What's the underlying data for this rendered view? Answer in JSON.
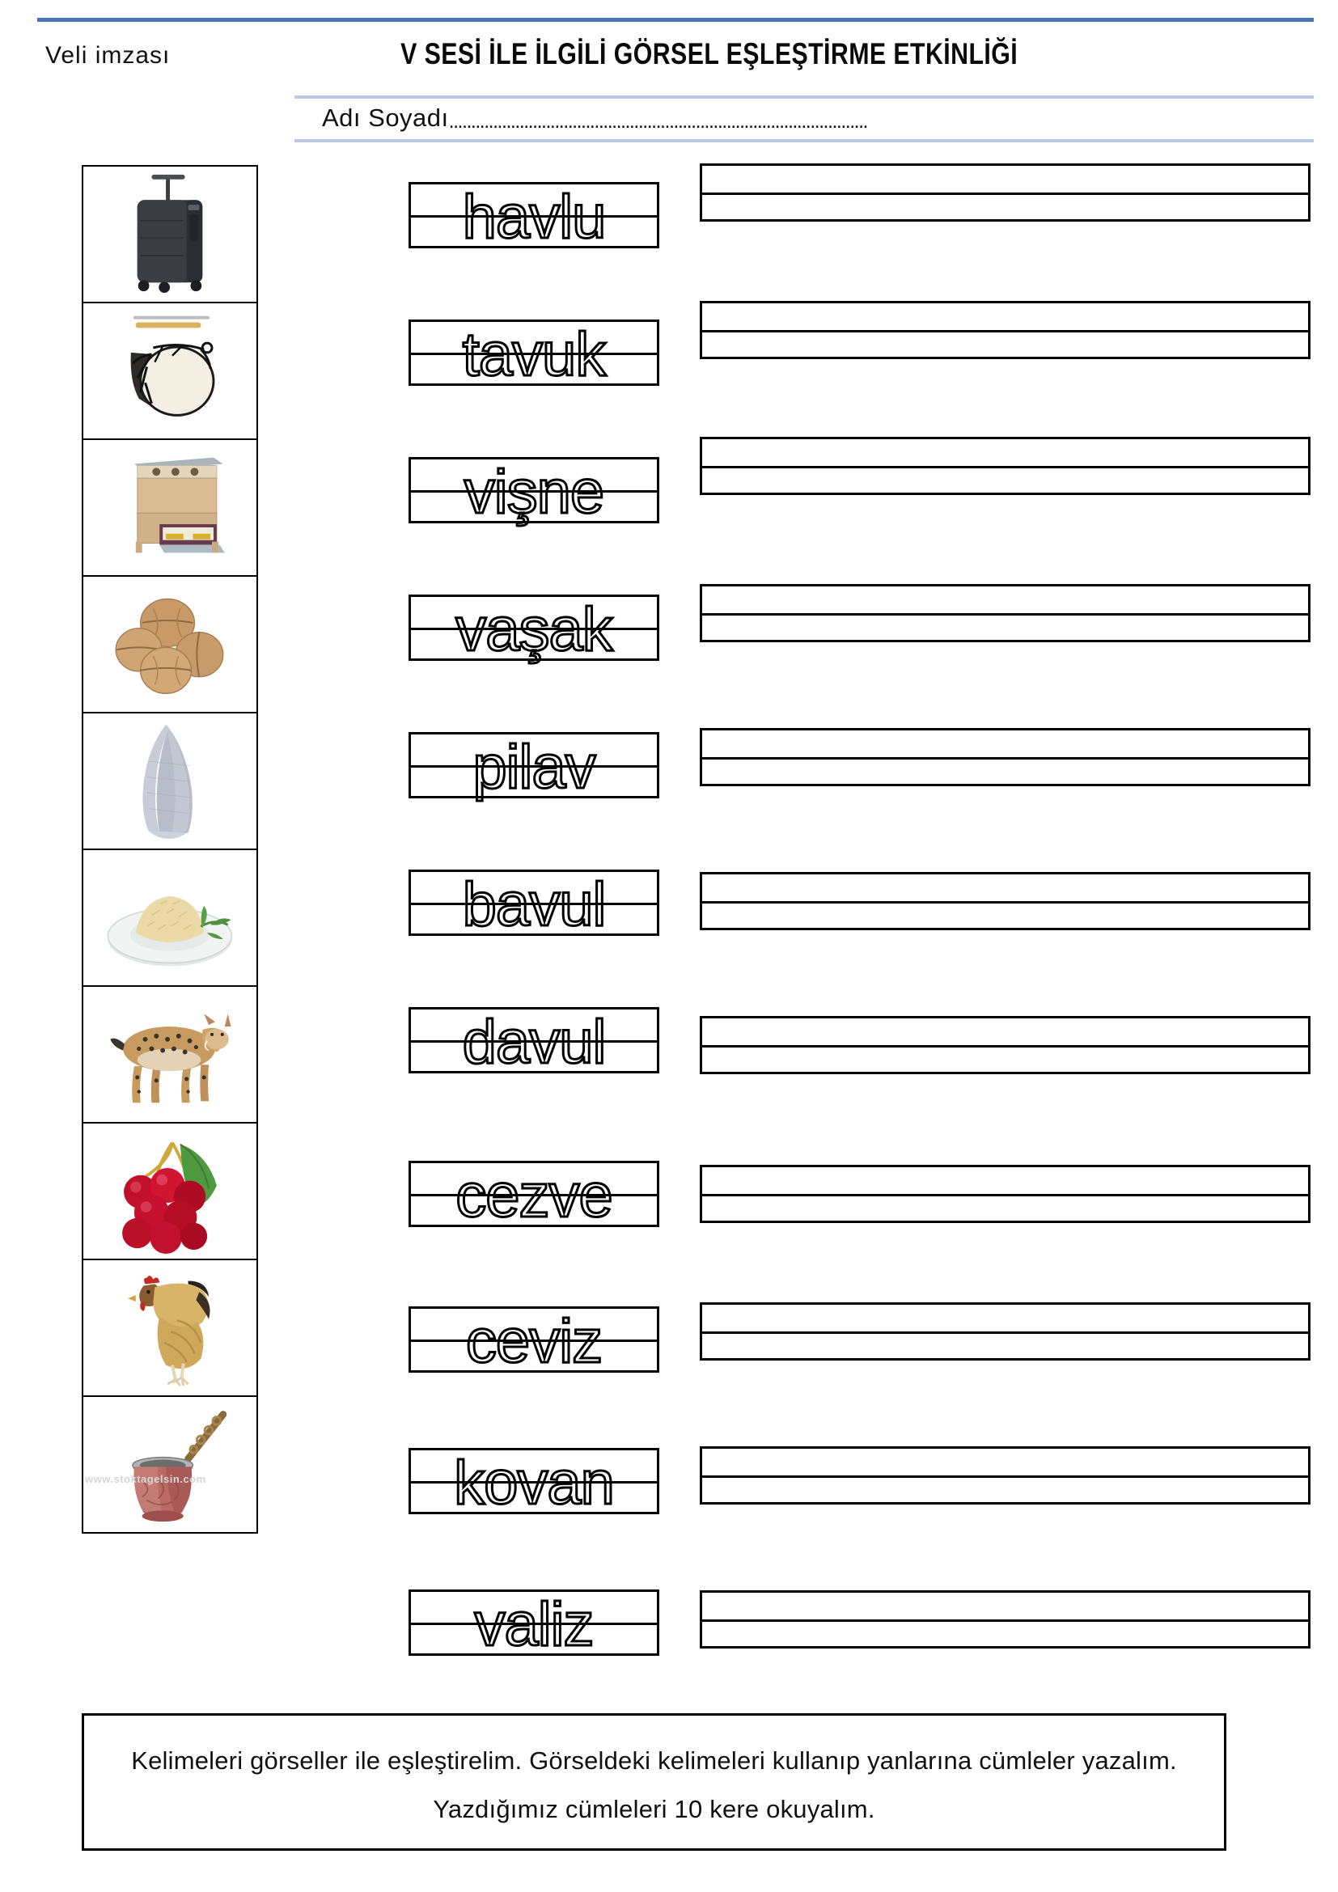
{
  "header": {
    "parent_signature_label": "Veli imzası",
    "title": "V SESİ İLE İLGİLİ GÖRSEL EŞLEŞTİRME ETKİNLİĞİ",
    "name_label": "Adı Soyadı",
    "name_dots": "...............................................................................................",
    "name_value": "",
    "rule_accent_color": "#4a76b8",
    "rule_light_color": "#bcc8e4"
  },
  "images": [
    {
      "name": "suitcase",
      "word": "bavul",
      "watermark": ""
    },
    {
      "name": "drum",
      "word": "davul",
      "watermark": ""
    },
    {
      "name": "beehive",
      "word": "kovan",
      "watermark": ""
    },
    {
      "name": "walnuts",
      "word": "ceviz",
      "watermark": ""
    },
    {
      "name": "towel",
      "word": "havlu",
      "watermark": ""
    },
    {
      "name": "rice-pilaf",
      "word": "pilav",
      "watermark": ""
    },
    {
      "name": "lynx",
      "word": "vaşak",
      "watermark": ""
    },
    {
      "name": "cherries",
      "word": "vişne",
      "watermark": ""
    },
    {
      "name": "chicken",
      "word": "tavuk",
      "watermark": ""
    },
    {
      "name": "coffee-pot-cezve",
      "word": "cezve",
      "watermark": "www.stoktagelsin.com"
    }
  ],
  "words": [
    {
      "text": "havlu"
    },
    {
      "text": "tavuk"
    },
    {
      "text": "vişne"
    },
    {
      "text": "vaşak"
    },
    {
      "text": "pilav"
    },
    {
      "text": "bavul"
    },
    {
      "text": "davul"
    },
    {
      "text": "cezve"
    },
    {
      "text": "ceviz"
    },
    {
      "text": "kovan"
    },
    {
      "text": "valiz"
    }
  ],
  "answer_rows": [
    {
      "value": ""
    },
    {
      "value": ""
    },
    {
      "value": ""
    },
    {
      "value": ""
    },
    {
      "value": ""
    },
    {
      "value": ""
    },
    {
      "value": ""
    },
    {
      "value": ""
    },
    {
      "value": ""
    },
    {
      "value": ""
    },
    {
      "value": ""
    }
  ],
  "instruction": {
    "text": "Kelimeleri görseller ile eşleştirelim. Görseldeki kelimeleri kullanıp yanlarına cümleler yazalım. Yazdığımız cümleleri 10 kere okuyalım."
  }
}
